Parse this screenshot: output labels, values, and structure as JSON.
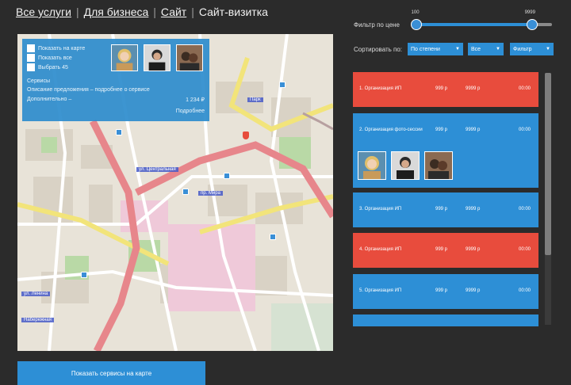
{
  "nav": {
    "items": [
      {
        "label": "Все услуги"
      },
      {
        "label": "Для бизнеса"
      },
      {
        "label": "Сайт"
      },
      {
        "label": "Сайт-визитка"
      }
    ],
    "separator": "|"
  },
  "overlay": {
    "options": [
      "Показать на карте",
      "Показать все",
      "Выбрать 45"
    ],
    "section_title": "Сервисы",
    "lines": [
      "Описание предложения – подробнее о сервисе",
      "Дополнительно –"
    ],
    "right_values": [
      "1 234 ₽",
      "Подробнее"
    ]
  },
  "map_labels": [
    "ул. Центральная",
    "пр. Мира",
    "ул. Ленина",
    "Набережная",
    "Парк"
  ],
  "bottom_button": {
    "label": "Показать сервисы на карте"
  },
  "slider": {
    "label": "Фильтр по цене",
    "min_label": "100",
    "max_label": "9999",
    "low": 0.02,
    "high": 0.85
  },
  "filters": {
    "label": "Сортировать по:",
    "selects": [
      {
        "value": "По степени"
      },
      {
        "value": "Все"
      },
      {
        "value": "Фильтр"
      }
    ]
  },
  "list": {
    "items": [
      {
        "title": "1. Организация ИП",
        "c1": "999 р",
        "c2": "9999 р",
        "c3": "00:00",
        "color": "#e84c3d"
      },
      {
        "title": "2. Организация фото-сессии",
        "c1": "999 р",
        "c2": "9999 р",
        "c3": "00:00",
        "color": "#2d8fd6"
      },
      {
        "title": "3. Организация ИП",
        "c1": "999 р",
        "c2": "9999 р",
        "c3": "00:00",
        "color": "#2d8fd6"
      },
      {
        "title": "4. Организация ИП",
        "c1": "999 р",
        "c2": "9999 р",
        "c3": "00:00",
        "color": "#e84c3d"
      },
      {
        "title": "5. Организация ИП",
        "c1": "999 р",
        "c2": "9999 р",
        "c3": "00:00",
        "color": "#2d8fd6"
      }
    ]
  },
  "colors": {
    "accent": "#2d8fd6",
    "alert": "#e84c3d",
    "background": "#2b2b2b"
  },
  "icons": [
    "checkbox-icon",
    "map-pin-icon",
    "caret-down-icon",
    "avatar-icon"
  ]
}
